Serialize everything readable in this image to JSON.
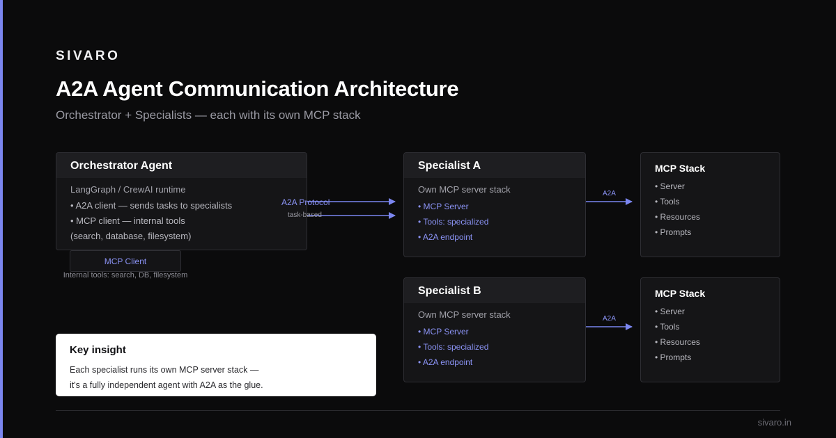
{
  "brand": "SIVARO",
  "title": "A2A Agent Communication Architecture",
  "subtitle": "Orchestrator + Specialists — each with its own MCP stack",
  "orchestrator": {
    "title": "Orchestrator Agent",
    "runtime": "LangGraph / CrewAI runtime",
    "lines": [
      "• A2A client — sends tasks to specialists",
      "• MCP client — internal tools",
      "(search, database, filesystem)"
    ]
  },
  "mcp_client": {
    "label": "MCP Client",
    "note": "Internal tools: search, DB, filesystem"
  },
  "protocol": {
    "label": "A2A Protocol",
    "sublabel": "task-based"
  },
  "specialists": [
    {
      "title": "Specialist A",
      "subtitle": "Own MCP server stack",
      "items": [
        "• MCP Server",
        "• Tools: specialized",
        "• A2A endpoint"
      ]
    },
    {
      "title": "Specialist B",
      "subtitle": "Own MCP server stack",
      "items": [
        "• MCP Server",
        "• Tools: specialized",
        "• A2A endpoint"
      ]
    }
  ],
  "stacks": [
    {
      "link_label": "A2A",
      "title": "MCP Stack",
      "items": [
        "• Server",
        "• Tools",
        "• Resources",
        "• Prompts"
      ]
    },
    {
      "link_label": "A2A",
      "title": "MCP Stack",
      "items": [
        "• Server",
        "• Tools",
        "• Resources",
        "• Prompts"
      ]
    }
  ],
  "insight": {
    "title": "Key insight",
    "lines": [
      "Each specialist runs its own MCP server stack —",
      "it's a fully independent agent with A2A as the glue."
    ]
  },
  "footer": {
    "url": "sivaro.in"
  },
  "colors": {
    "background": "#0b0b0c",
    "accent": "#7b86f0",
    "card": "#151517",
    "card_header": "#1e1e21",
    "border": "#2e2e33",
    "insight_bg": "#ffffff"
  }
}
